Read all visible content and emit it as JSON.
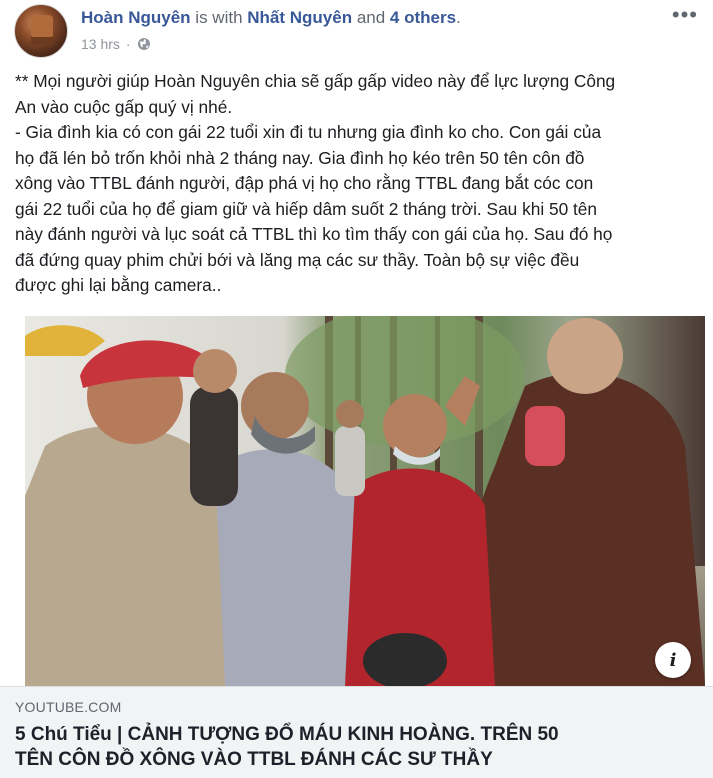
{
  "post": {
    "author": "Hoàn Nguyên",
    "with_text": " is with ",
    "tagged_person": "Nhất Nguyên",
    "and_text": " and ",
    "others": "4 others",
    "period": ".",
    "timestamp": "13 hrs",
    "dot": "·",
    "more_label": "•••",
    "audience_icon": "globe-icon",
    "text_lines": [
      "** Mọi người giúp Hoàn Nguyên chia sẽ gấp gấp video này để lực lượng Công",
      "An vào cuộc gấp quý vị nhé.",
      "- Gia đình kia có con gái 22 tuổi xin đi tu nhưng gia đình ko cho. Con gái của",
      "họ đã lén bỏ trốn khỏi nhà 2 tháng nay. Gia đình họ kéo trên 50 tên côn đồ",
      "xông vào TTBL đánh người, đập phá vị họ cho rằng TTBL đang bắt cóc con",
      "gái 22 tuổi của họ để giam giữ và hiếp dâm suốt 2 tháng trời. Sau khi 50 tên",
      "này đánh người và lục soát cả TTBL thì ko tìm thấy con gái của họ. Sau đó họ",
      "đã đứng quay phim chửi bới và lăng mạ các sư thầy. Toàn bộ sự việc đều",
      "được ghi lại bằng camera.."
    ]
  },
  "media": {
    "info_label": "i"
  },
  "link_preview": {
    "domain": "YOUTUBE.COM",
    "title_line1": "5 Chú Tiểu | CẢNH TƯỢNG ĐỔ MÁU KINH HOÀNG. TRÊN 50",
    "title_line2": "TÊN CÔN ĐỒ XÔNG VÀO TTBL ĐÁNH CÁC SƯ THẦY"
  },
  "colors": {
    "author_link": "#385898",
    "meta_gray": "#90949c",
    "link_box_bg": "#f2f3f5"
  }
}
